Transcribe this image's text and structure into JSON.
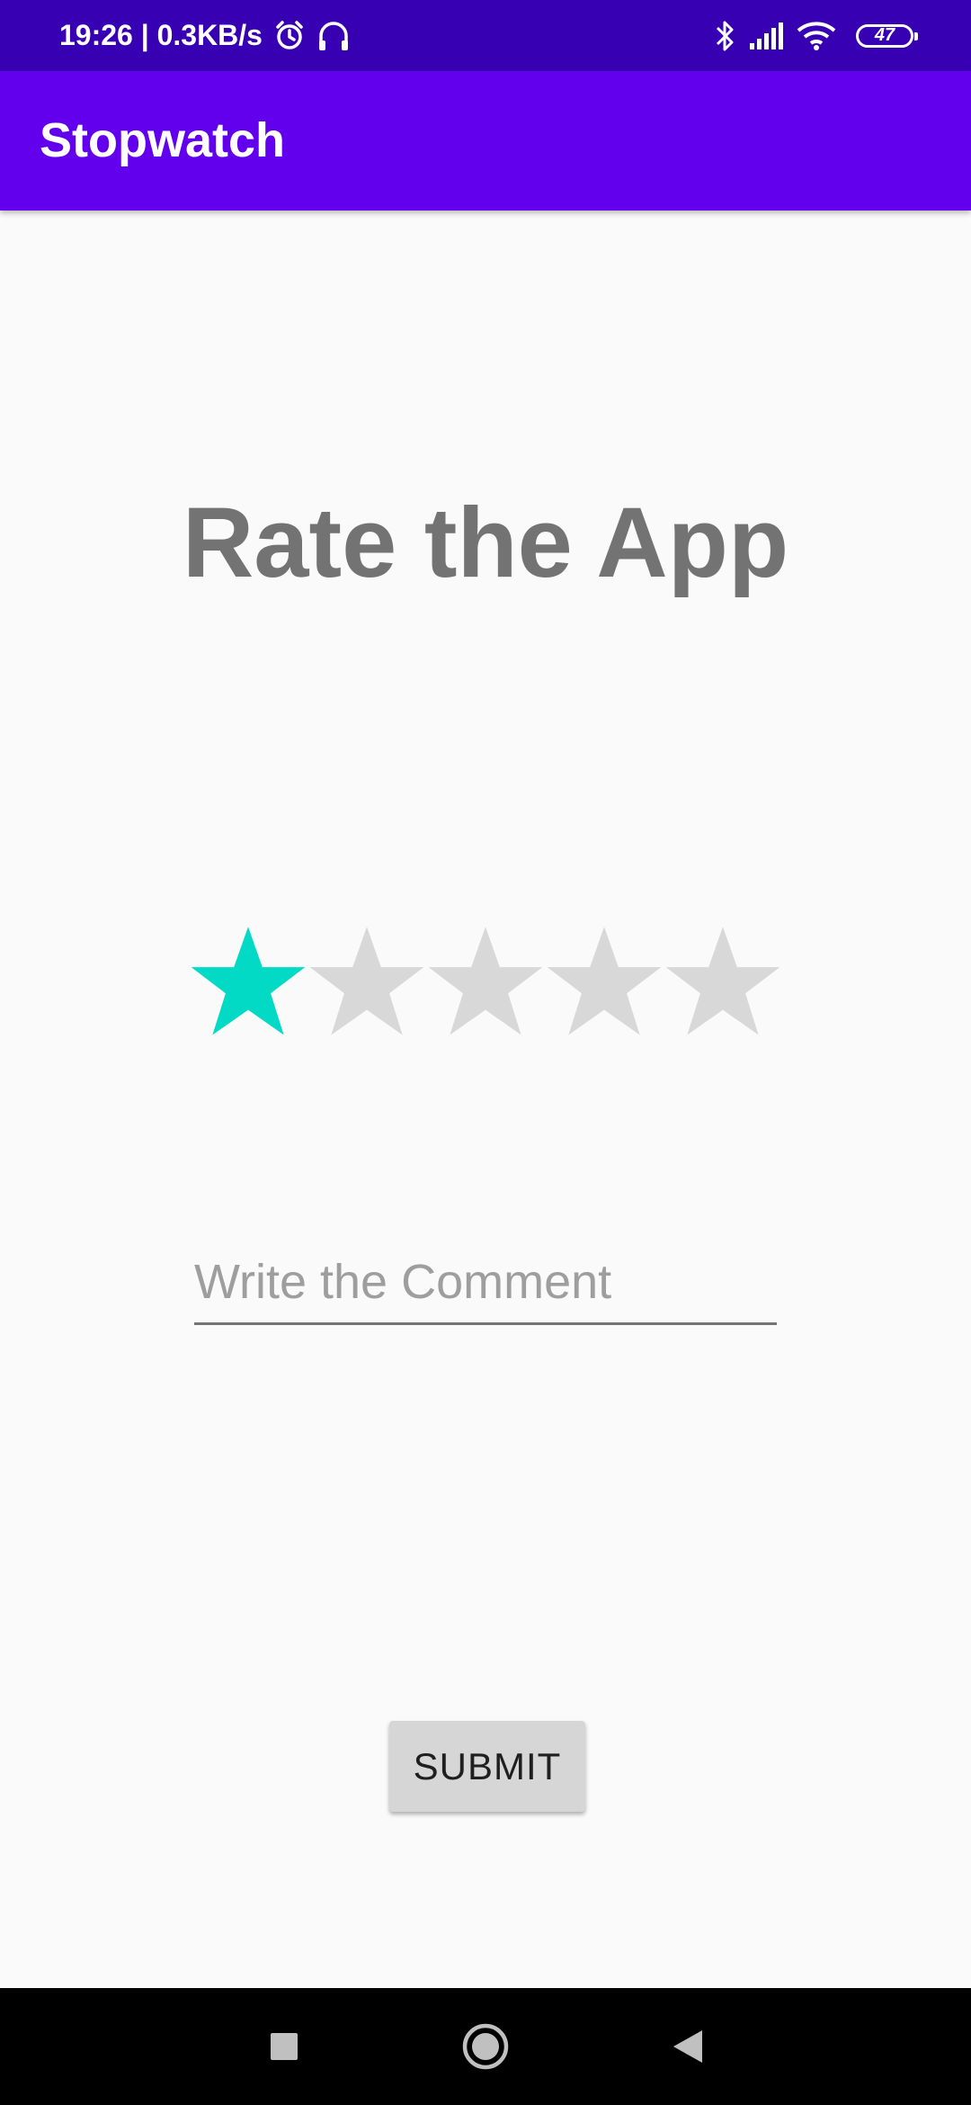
{
  "status_bar": {
    "time_speed": "19:26 | 0.3KB/s",
    "battery_level": "47",
    "icons": [
      "alarm-icon",
      "headphones-icon",
      "bluetooth-icon",
      "signal-icon",
      "wifi-icon",
      "battery-icon"
    ]
  },
  "app_bar": {
    "title": "Stopwatch",
    "color": "#6200ee",
    "status_color": "#3700b3"
  },
  "main": {
    "heading": "Rate the App",
    "rating": {
      "value": 1,
      "max": 5,
      "filled_color": "#03dac5",
      "empty_color": "#d8d8d8"
    },
    "comment": {
      "placeholder": "Write the Comment",
      "value": ""
    },
    "submit_label": "SUBMIT"
  },
  "nav_bar": {
    "buttons": [
      "recents-square-icon",
      "home-circle-icon",
      "back-triangle-icon"
    ]
  }
}
